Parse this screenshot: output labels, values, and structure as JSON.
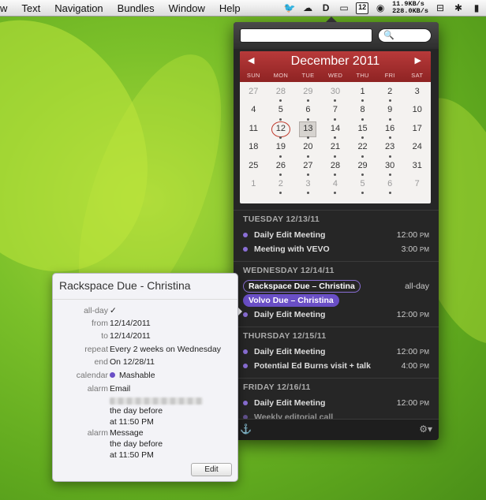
{
  "menubar": {
    "items": [
      "w",
      "Text",
      "Navigation",
      "Bundles",
      "Window",
      "Help"
    ],
    "calendar_icon_day": "12",
    "net_up": "11.9KB/s",
    "net_down": "228.0KB/s"
  },
  "calendar": {
    "month_title": "December 2011",
    "prev_label": "◀",
    "next_label": "▶",
    "weekdays": [
      "SUN",
      "MON",
      "TUE",
      "WED",
      "THU",
      "FRI",
      "SAT"
    ],
    "today": 12,
    "selected": 13
  },
  "events": {
    "day1": {
      "header": "TUESDAY 12/13/11",
      "e1": {
        "title": "Daily Edit Meeting",
        "time": "12:00",
        "ampm": "PM"
      },
      "e2": {
        "title": "Meeting with VEVO",
        "time": "3:00",
        "ampm": "PM"
      }
    },
    "day2": {
      "header": "WEDNESDAY 12/14/11",
      "e1": {
        "title": "Rackspace Due – Christina",
        "time": "all-day"
      },
      "e2": {
        "title": "Volvo Due – Christina"
      },
      "e3": {
        "title": "Daily Edit Meeting",
        "time": "12:00",
        "ampm": "PM"
      }
    },
    "day3": {
      "header": "THURSDAY 12/15/11",
      "e1": {
        "title": "Daily Edit Meeting",
        "time": "12:00",
        "ampm": "PM"
      },
      "e2": {
        "title": "Potential Ed Burns visit + talk",
        "time": "4:00",
        "ampm": "PM"
      }
    },
    "day4": {
      "header": "FRIDAY 12/16/11",
      "e1": {
        "title": "Daily Edit Meeting",
        "time": "12:00",
        "ampm": "PM"
      },
      "e2": {
        "title": "Weekly editorial call"
      }
    }
  },
  "detail": {
    "title": "Rackspace Due - Christina",
    "all_day_label": "all-day",
    "all_day_value": "✓",
    "from_label": "from",
    "from_value": "12/14/2011",
    "to_label": "to",
    "to_value": "12/14/2011",
    "repeat_label": "repeat",
    "repeat_value": "Every 2 weeks on Wednesday",
    "end_label": "end",
    "end_value": "On 12/28/11",
    "calendar_label": "calendar",
    "calendar_value": "Mashable",
    "alarm1_label": "alarm",
    "alarm1_type": "Email",
    "alarm1_when": "the day before",
    "alarm1_time": "at 11:50  PM",
    "alarm2_label": "alarm",
    "alarm2_type": "Message",
    "alarm2_when": "the day before",
    "alarm2_time": "at 11:50  PM",
    "edit_label": "Edit"
  },
  "colors": {
    "accent": "#8a6fd6",
    "calendar_header": "#a12f2f"
  }
}
